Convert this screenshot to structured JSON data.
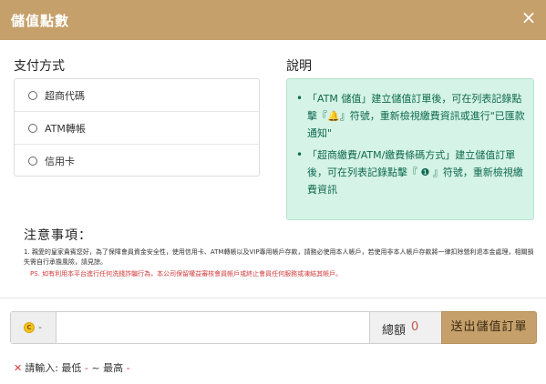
{
  "header": {
    "title": "儲值點數",
    "close_icon": "×"
  },
  "payment": {
    "title": "支付方式",
    "options": [
      "超商代碼",
      "ATM轉帳",
      "信用卡"
    ]
  },
  "description": {
    "title": "說明",
    "items": [
      "「ATM 儲值」建立儲值訂單後，可在列表記錄點擊『🔔』符號，重新檢視繳費資訊或進行\"已匯款通知\"",
      "「超商繳費/ATM/繳費條碼方式」建立儲值訂單後，可在列表記錄點擊『 ❶ 』符號，重新檢視繳費資訊"
    ]
  },
  "notice": {
    "title": "注意事項：",
    "text": "1. 親愛的皇家貴賓您好，為了保障會員資金安全性，使用信用卡、ATM轉帳以及VIP專用帳戶存款，請務必使用本人帳戶，若使用非本人帳戶存款將一律扣除營利退本金處理，相關損失需自行承擔風險，請見諒。",
    "warning": "PS. 如有利用本平台進行任何洗錢詐騙行為，本公司保留權益審核會員帳戶或終止會員任何服務或凍結其帳戶。"
  },
  "amount": {
    "coin_icon": "coin-icon",
    "coin_symbol": "C",
    "coin_dash": "-",
    "input_value": "",
    "total_label": "總額",
    "total_value": "0",
    "submit_label": "送出儲值訂單"
  },
  "hint": {
    "star": "✕",
    "prefix": "請輸入: 最低",
    "min": "-",
    "mid": " ~ 最高",
    "max": "-"
  },
  "colors": {
    "accent": "#c6a06b",
    "info_bg": "#d5f3e6",
    "info_text": "#0f6a50",
    "warn": "#d13b3b"
  }
}
